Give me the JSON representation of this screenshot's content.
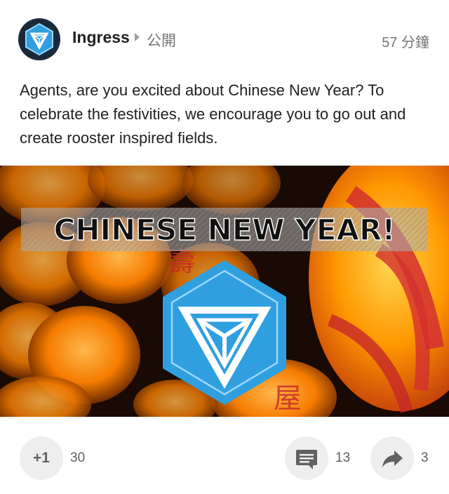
{
  "post": {
    "author": "Ingress",
    "visibility": "公開",
    "timestamp": "57 分鐘",
    "text": "Agents, are you excited about Chinese New Year? To celebrate the festivities, we encourage you to go out and create rooster inspired fields.",
    "image": {
      "banner_text": "CHINESE NEW YEAR!",
      "logo": "ingress-logo-icon"
    }
  },
  "actions": {
    "plus_one_label": "+1",
    "plus_one_count": "30",
    "comment_icon": "comment-icon",
    "comment_count": "13",
    "share_icon": "share-icon",
    "share_count": "3"
  },
  "colors": {
    "brand_blue": "#1e88e5",
    "lantern_orange": "#f57c00",
    "lantern_red": "#d32f2f"
  }
}
